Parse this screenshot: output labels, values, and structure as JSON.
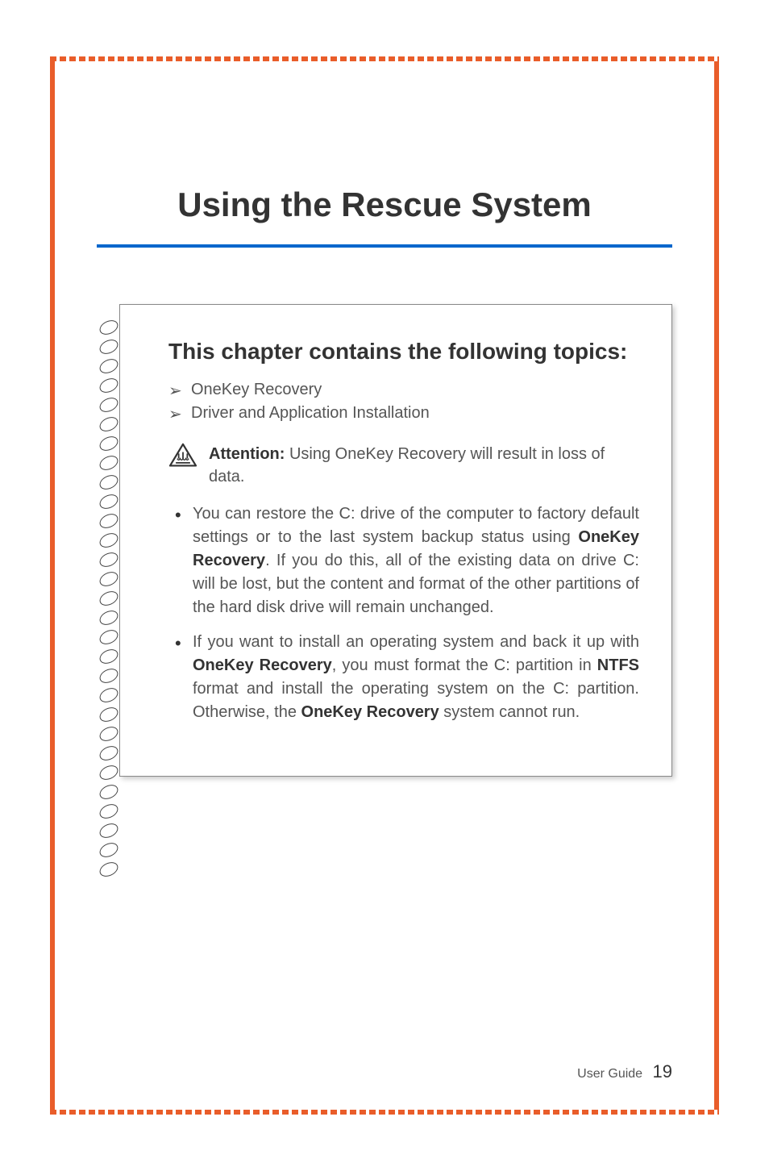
{
  "chapter": {
    "title": "Using the Rescue System"
  },
  "infobox": {
    "heading": "This chapter contains the following topics:",
    "topics": [
      "OneKey Recovery",
      "Driver and Application Installation"
    ],
    "attention": {
      "label": "Attention:",
      "text": " Using OneKey Recovery will result in loss of data."
    },
    "bullets": [
      {
        "pre": "You can restore the C: drive of the computer to factory default settings or to the last system backup status using ",
        "bold1": "OneKey Recovery",
        "post": ". If you do this, all of the existing data on drive C: will be lost, but the content and format of the other partitions of the hard disk drive will remain unchanged."
      },
      {
        "pre": "If you want to install an operating system and back it up with ",
        "bold1": "OneKey Recovery",
        "mid1": ", you must format the C: partition in ",
        "bold2": "NTFS",
        "mid2": " format and install the operating system on the C: partition. Otherwise, the ",
        "bold3": "OneKey Recovery",
        "post": " system cannot run."
      }
    ]
  },
  "footer": {
    "label": "User Guide",
    "page": "19"
  }
}
